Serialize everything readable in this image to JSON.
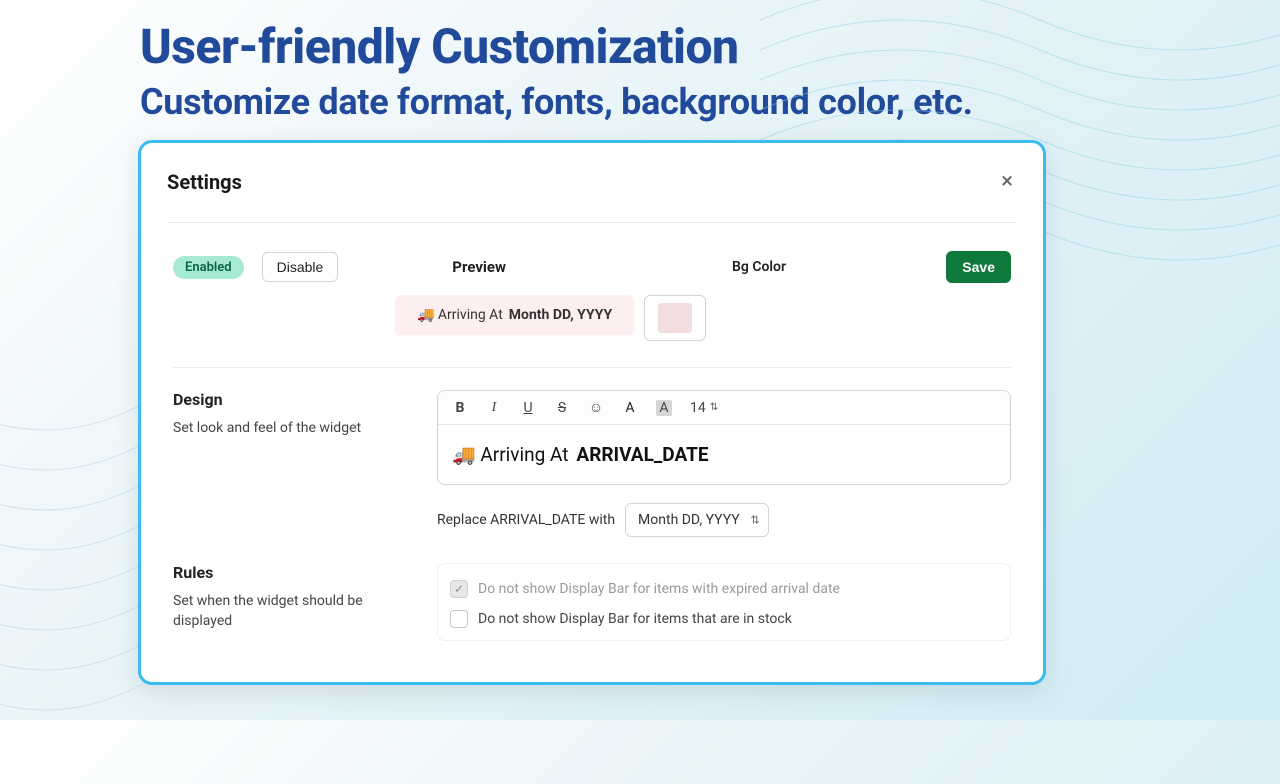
{
  "hero": {
    "title": "User-friendly Customization",
    "subtitle": "Customize date format, fonts, background color, etc."
  },
  "modal": {
    "title": "Settings",
    "close_label": "×"
  },
  "top": {
    "enabled_badge": "Enabled",
    "disable_label": "Disable",
    "preview_label": "Preview",
    "bgcolor_label": "Bg Color",
    "save_label": "Save",
    "preview_text_prefix": "🚚 Arriving At",
    "preview_text_date": "Month DD, YYYY",
    "bg_swatch_color": "#f2dede"
  },
  "design": {
    "title": "Design",
    "desc": "Set look and feel of the widget",
    "toolbar": {
      "bold": "B",
      "italic": "I",
      "underline": "U",
      "strike": "S",
      "emoji": "☺",
      "textcolor": "A",
      "highlight": "A",
      "fontsize": "14"
    },
    "editor_prefix": "🚚 Arriving At",
    "editor_var": "ARRIVAL_DATE",
    "replace_label": "Replace ARRIVAL_DATE with",
    "replace_value": "Month DD, YYYY"
  },
  "rules": {
    "title": "Rules",
    "desc": "Set when the widget should be displayed",
    "items": [
      {
        "label": "Do not show Display Bar for items with expired arrival date",
        "checked": true,
        "disabled": true
      },
      {
        "label": "Do not show Display Bar for items that are in stock",
        "checked": false,
        "disabled": false
      }
    ]
  }
}
